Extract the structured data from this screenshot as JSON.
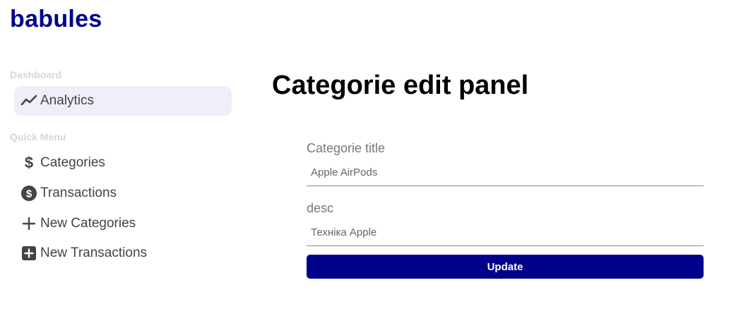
{
  "app": {
    "logo": "babules"
  },
  "sidebar": {
    "sections": [
      {
        "label": "Dashboard"
      },
      {
        "label": "Quick Menu"
      }
    ],
    "items": [
      {
        "label": "Analytics",
        "icon": "trending-up-icon",
        "active": true
      },
      {
        "label": "Categories",
        "icon": "dollar-sign-icon"
      },
      {
        "label": "Transactions",
        "icon": "dollar-circle-icon"
      },
      {
        "label": "New Categories",
        "icon": "plus-icon"
      },
      {
        "label": "New Transactions",
        "icon": "plus-box-icon"
      }
    ]
  },
  "main": {
    "title": "Categorie edit panel",
    "form": {
      "title_label": "Categorie title",
      "title_value": "Apple AirPods",
      "desc_label": "desc",
      "desc_value": "Техніка Apple",
      "submit_label": "Update"
    }
  },
  "colors": {
    "brand": "#00008b",
    "active_bg": "#efeffa"
  }
}
